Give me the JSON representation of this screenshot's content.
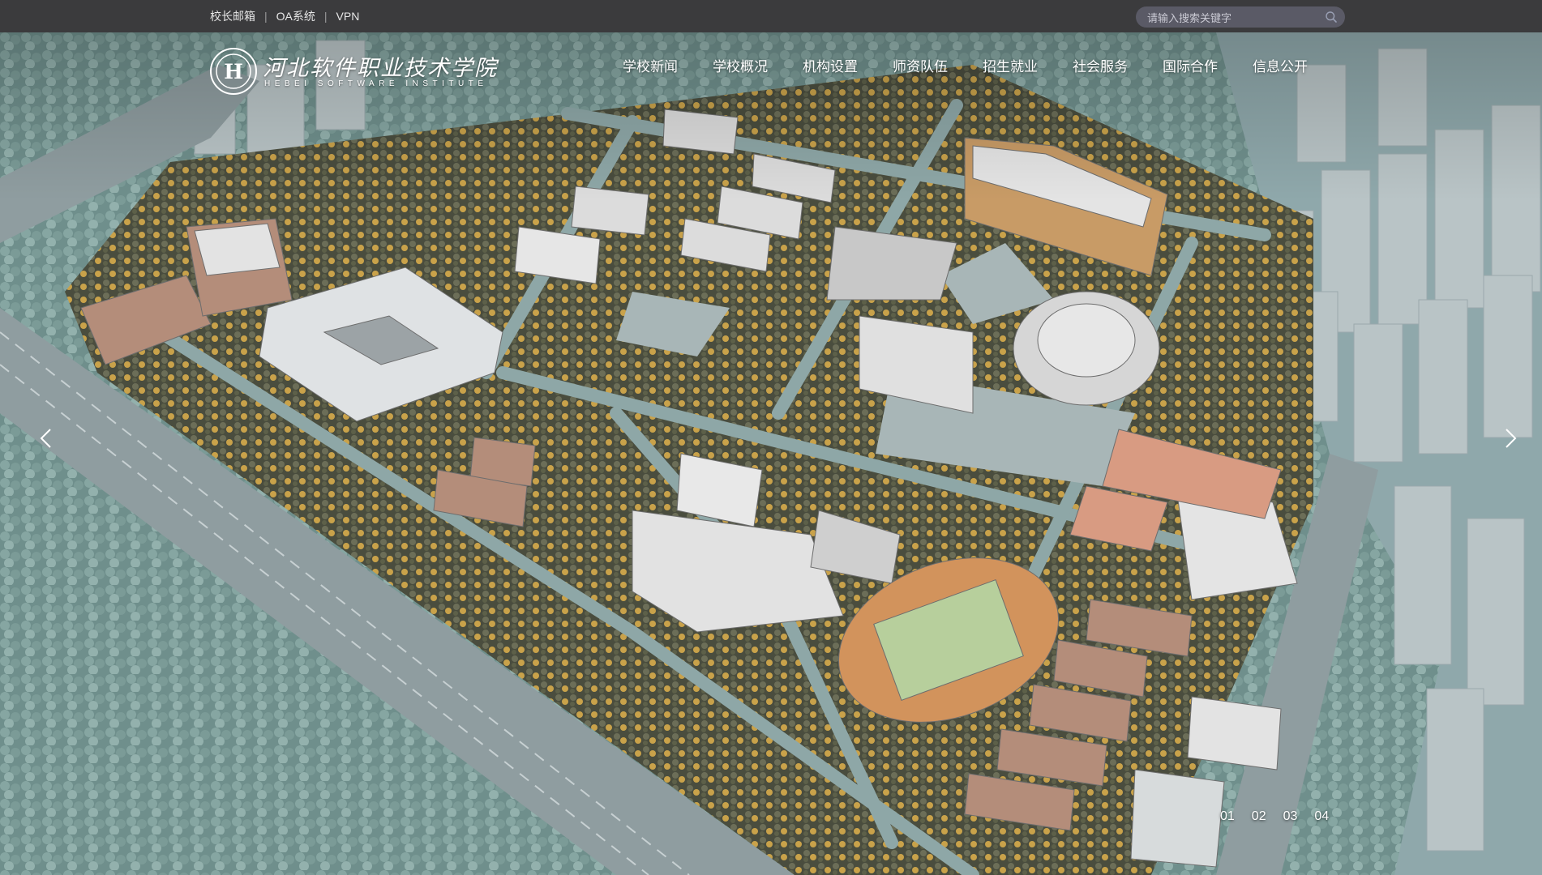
{
  "topbar": {
    "links": [
      "校长邮箱",
      "OA系统",
      "VPN"
    ],
    "separator": "|"
  },
  "search": {
    "placeholder": "请输入搜索关键字",
    "icon": "search-icon"
  },
  "logo": {
    "name_cn": "河北软件职业技术学院",
    "name_en": "HEBEI SOFTWARE INSTITUTE",
    "emblem_letter": "H"
  },
  "nav": {
    "items": [
      "学校新闻",
      "学校概况",
      "机构设置",
      "师资队伍",
      "招生就业",
      "社会服务",
      "国际合作",
      "信息公开"
    ]
  },
  "slider": {
    "pages": [
      "01",
      "02",
      "03",
      "04"
    ],
    "prev_icon": "chevron-left-icon",
    "next_icon": "chevron-right-icon"
  },
  "colors": {
    "topbar_bg": "#3b3b3d",
    "search_bg": "#5a5a66"
  }
}
